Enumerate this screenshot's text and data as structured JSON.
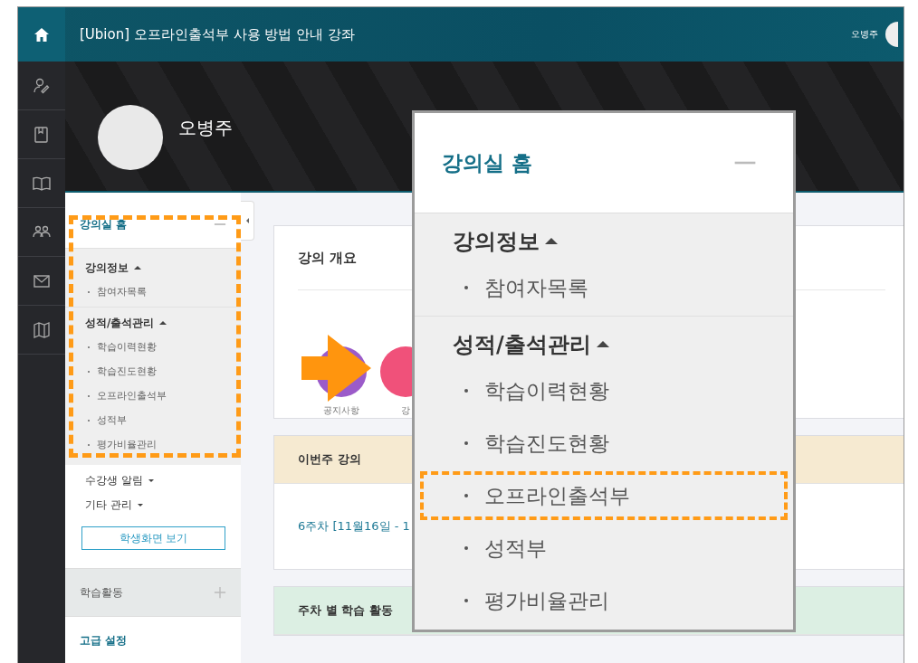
{
  "header": {
    "title": "[Ubion] 오프라인출석부 사용 방법 안내 강좌",
    "user_name": "오병주"
  },
  "banner": {
    "name": "오병주"
  },
  "sidebar": {
    "home": {
      "label": "강의실 홈",
      "expanded": true
    },
    "groups": [
      {
        "label": "강의정보",
        "expanded": true,
        "items": [
          "참여자목록"
        ]
      },
      {
        "label": "성적/출석관리",
        "expanded": true,
        "items": [
          "학습이력현황",
          "학습진도현황",
          "오프라인출석부",
          "성적부",
          "평가비율관리"
        ]
      },
      {
        "label": "수강생 알림",
        "expanded": false
      },
      {
        "label": "기타 관리",
        "expanded": false
      }
    ],
    "button": "학생화면 보기",
    "sections": [
      {
        "kind": "toggle",
        "label": "학습활동",
        "expanded": false
      },
      {
        "kind": "link",
        "label": "고급 설정"
      }
    ]
  },
  "main": {
    "overview": {
      "title": "강의 개요",
      "shortcuts": [
        {
          "label": "공지사항",
          "color": "#9b5bc9"
        },
        {
          "label": "강",
          "color": "#f0517a"
        }
      ]
    },
    "this_week": {
      "title": "이번주 강의",
      "link": "6주차 [11월16일 - 1"
    },
    "weekly": {
      "title": "주차 별 학습 활동"
    }
  },
  "callout": {
    "home": {
      "label": "강의실 홈",
      "expanded": true
    },
    "groups": [
      {
        "label": "강의정보",
        "expanded": true,
        "items": [
          {
            "label": "참여자목록",
            "highlighted": false
          }
        ]
      },
      {
        "label": "성적/출석관리",
        "expanded": true,
        "items": [
          {
            "label": "학습이력현황",
            "highlighted": false
          },
          {
            "label": "학습진도현황",
            "highlighted": false
          },
          {
            "label": "오프라인출석부",
            "highlighted": true
          },
          {
            "label": "성적부",
            "highlighted": false
          },
          {
            "label": "평가비율관리",
            "highlighted": false
          }
        ]
      }
    ]
  }
}
